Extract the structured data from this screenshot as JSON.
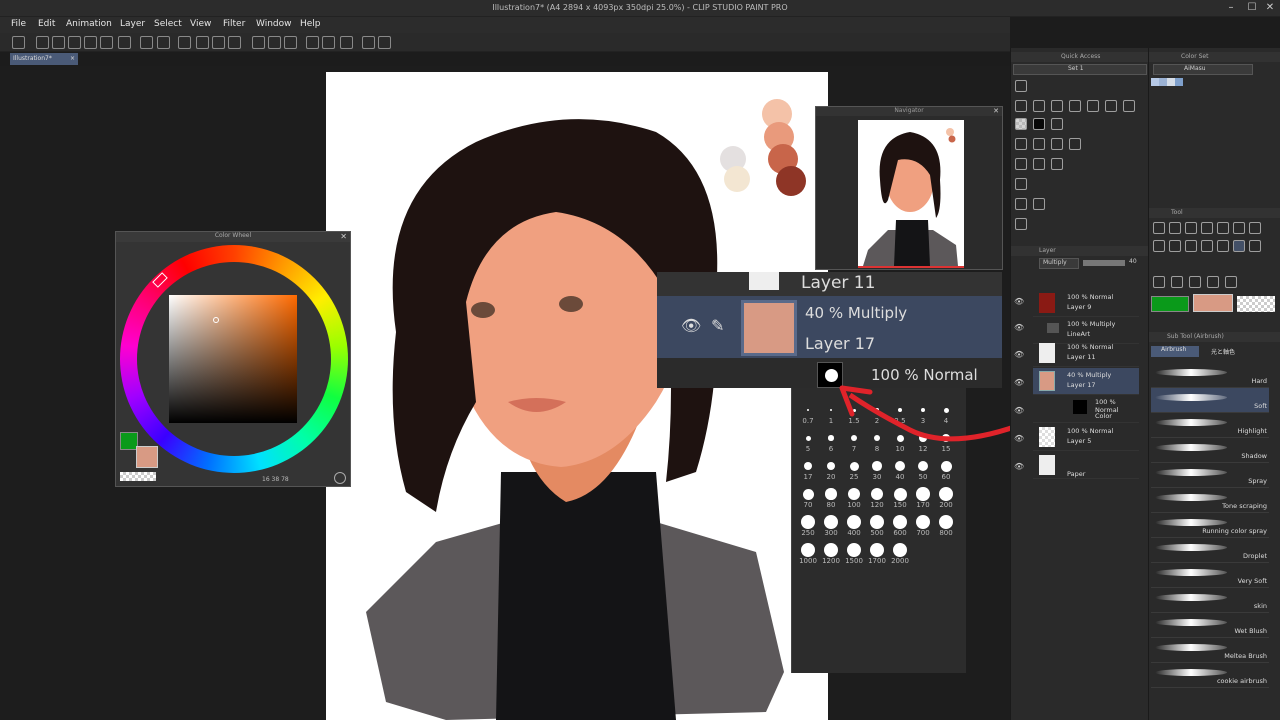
{
  "app": {
    "title": "Illustration7* (A4 2894 x 4093px 350dpi 25.0%) - CLIP STUDIO PAINT PRO",
    "doc_tab": "Illustration7*"
  },
  "menu": [
    "File",
    "Edit",
    "Animation",
    "Layer",
    "Select",
    "View",
    "Filter",
    "Window",
    "Help"
  ],
  "panels": {
    "quick_access": "Quick Access",
    "quick_access_set": "Set 1",
    "color_set": "Color Set",
    "color_set_name": "AiMasu",
    "navigator": "Navigator",
    "color_wheel": "Color Wheel",
    "color_wheel_values": "16 38 78",
    "tool": "Tool",
    "layer": "Layer",
    "layer_blend": "Multiply",
    "layer_opacity": "40",
    "subtool": "Sub Tool (Airbrush)",
    "subtool_tab": "Airbrush",
    "subtool_tab2": "光と軸色"
  },
  "zoom_popup": {
    "top_name": "Layer 11",
    "mode": "40 % Multiply",
    "name": "Layer 17",
    "bottom_mode": "100 % Normal"
  },
  "layers": [
    {
      "mode": "100 % Normal",
      "name": "Layer 9"
    },
    {
      "mode": "100 % Multiply",
      "name": "LineArt"
    },
    {
      "mode": "100 % Normal",
      "name": "Layer 11"
    },
    {
      "mode": "40 % Multiply",
      "name": "Layer 17"
    },
    {
      "mode": "100 % Normal",
      "name": "Color"
    },
    {
      "mode": "100 % Normal",
      "name": "Layer 5"
    },
    {
      "mode": "",
      "name": "Paper"
    }
  ],
  "brush_sizes": [
    "0.7",
    "1",
    "1.5",
    "2",
    "2.5",
    "3",
    "4",
    "5",
    "6",
    "7",
    "8",
    "10",
    "12",
    "15",
    "17",
    "20",
    "25",
    "30",
    "40",
    "50",
    "60",
    "70",
    "80",
    "100",
    "120",
    "150",
    "170",
    "200",
    "250",
    "300",
    "400",
    "500",
    "600",
    "700",
    "800",
    "1000",
    "1200",
    "1500",
    "1700",
    "2000"
  ],
  "brushes": [
    "Hard",
    "Soft",
    "Highlight",
    "Shadow",
    "Spray",
    "Tone scraping",
    "Running color spray",
    "Droplet",
    "Very Soft",
    "skin",
    "Wet Blush",
    "Meltea Brush",
    "cookie airbrush"
  ],
  "colors": {
    "main": "#d89a84",
    "sub": "#0a9a1a",
    "accent": "#e0232a",
    "palette": [
      "#f4c2a8",
      "#e99a7c",
      "#c8654a",
      "#8e3526",
      "#f3e6d2",
      "#e4e0e0"
    ]
  }
}
